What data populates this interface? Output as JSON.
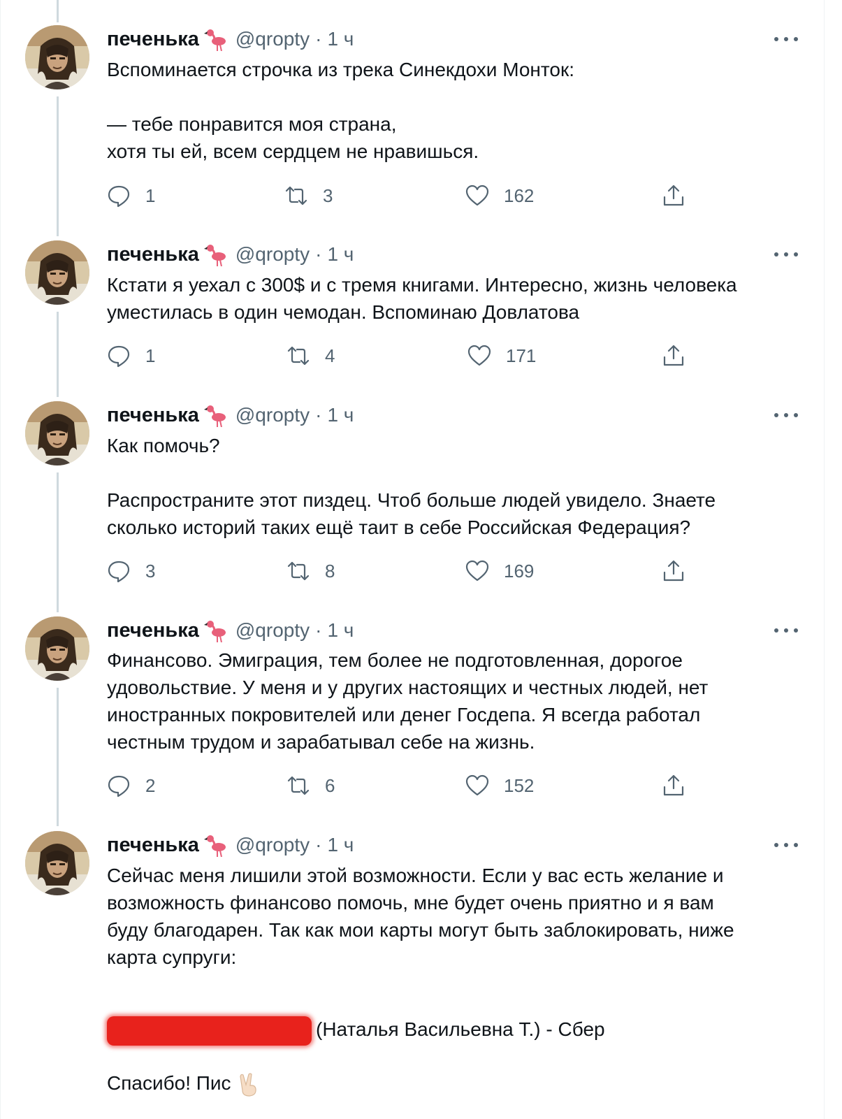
{
  "author": {
    "name": "печенька",
    "handle": "@qropty",
    "separator": "·",
    "time": "1 ч"
  },
  "tweets": [
    {
      "text": "Вспоминается строчка из трека Синекдохи Монток:\n\n— тебе понравится моя страна,\nхотя ты ей, всем сердцем не нравишься.",
      "replies": "1",
      "retweets": "3",
      "likes": "162"
    },
    {
      "text": "Кстати я уехал с 300$ и с тремя книгами. Интересно, жизнь человека\nуместилась в один чемодан. Вспоминаю Довлатова",
      "replies": "1",
      "retweets": "4",
      "likes": "171"
    },
    {
      "text": "Как помочь?\n\nРаспространите этот пиздец. Чтоб больше людей увидело. Знаете\nсколько историй таких ещё таит в себе Российская Федерация?",
      "replies": "3",
      "retweets": "8",
      "likes": "169"
    },
    {
      "text": "Финансово. Эмиграция, тем более не подготовленная, дорогое\nудовольствие. У меня и у других настоящих и честных людей, нет\nиностранных покровителей или денег Госдепа. Я всегда работал\nчестным трудом и зарабатывал себе на жизнь.",
      "replies": "2",
      "retweets": "6",
      "likes": "152"
    },
    {
      "text": "Сейчас меня лишили этой возможности. Если у вас есть желание и\nвозможность финансово помочь, мне будет очень приятно и я вам\nбуду благодарен. Так как мои карты могут быть заблокировать, ниже\nкарта супруги:",
      "card_owner": "(Наталья Васильевна Т.) - Сбер",
      "closing": "Спасибо! Пис"
    }
  ],
  "icons": {
    "reply": "reply-icon",
    "retweet": "retweet-icon",
    "like": "heart-icon",
    "share": "share-icon",
    "more": "more-icon",
    "emoji_name": "flamingo-icon",
    "emoji_end": "victory-hand-icon"
  },
  "colors": {
    "text": "#0f1419",
    "secondary": "#536471",
    "thread_line": "#cfd9de",
    "redaction": "#e8221c",
    "flamingo": "#e8607a"
  }
}
